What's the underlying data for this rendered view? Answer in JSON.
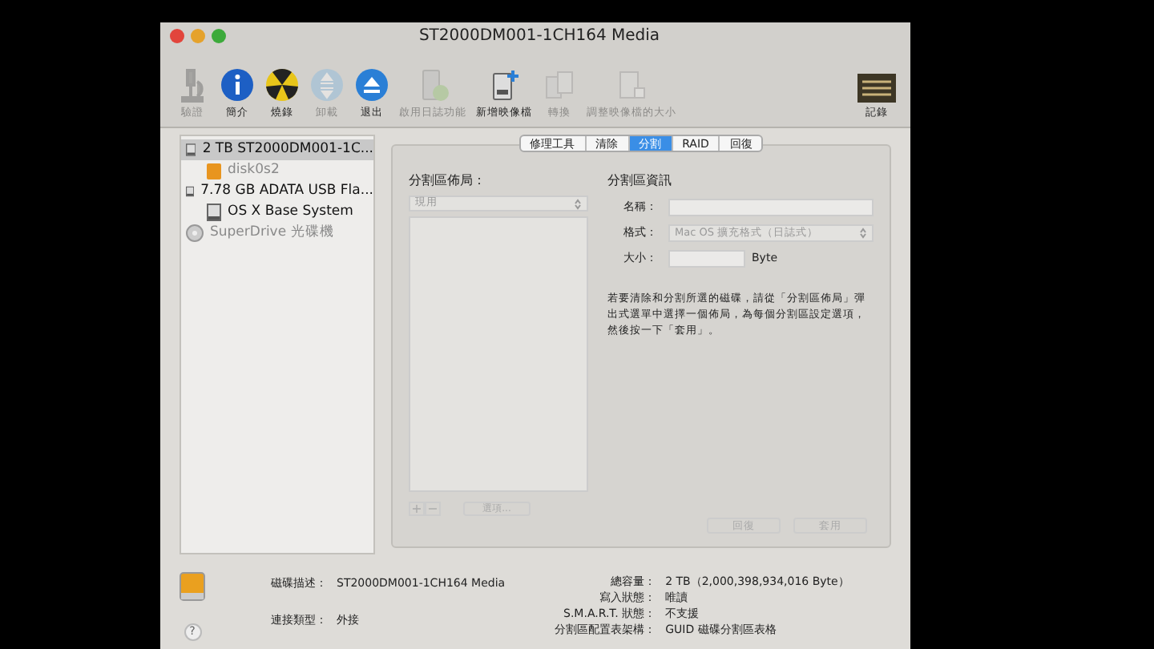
{
  "window": {
    "title": "ST2000DM001-1CH164 Media"
  },
  "toolbar": [
    {
      "label": "驗證",
      "disabled": true,
      "kind": "microscope"
    },
    {
      "label": "簡介",
      "disabled": false,
      "kind": "info"
    },
    {
      "label": "燒錄",
      "disabled": false,
      "kind": "burn"
    },
    {
      "label": "卸載",
      "disabled": true,
      "kind": "unmount"
    },
    {
      "label": "退出",
      "disabled": false,
      "kind": "eject"
    },
    {
      "label": "啟用日誌功能",
      "disabled": true,
      "kind": "journal"
    },
    {
      "label": "新增映像檔",
      "disabled": false,
      "kind": "newimage"
    },
    {
      "label": "轉換",
      "disabled": true,
      "kind": "convert"
    },
    {
      "label": "調整映像檔的大小",
      "disabled": true,
      "kind": "resize"
    },
    {
      "label": "記錄",
      "disabled": false,
      "kind": "log"
    }
  ],
  "sidebar": [
    {
      "label": "2 TB ST2000DM001-1C...",
      "selected": true,
      "disabled": false,
      "kind": "disk",
      "children": [
        {
          "label": "disk0s2",
          "selected": false,
          "disabled": true,
          "kind": "volume"
        }
      ]
    },
    {
      "label": "7.78 GB ADATA USB Fla...",
      "selected": false,
      "disabled": false,
      "kind": "disk",
      "children": [
        {
          "label": "OS X Base System",
          "selected": false,
          "disabled": false,
          "kind": "disk"
        }
      ]
    },
    {
      "label": "SuperDrive 光碟機",
      "selected": false,
      "disabled": true,
      "kind": "optical"
    }
  ],
  "tabs": [
    {
      "label": "修理工具",
      "selected": false
    },
    {
      "label": "清除",
      "selected": false
    },
    {
      "label": "分割",
      "selected": true
    },
    {
      "label": "RAID",
      "selected": false
    },
    {
      "label": "回復",
      "selected": false
    }
  ],
  "layout": {
    "title": "分割區佈局：",
    "dropdown": "現用",
    "add": "+",
    "remove": "−",
    "options_button": "選項..."
  },
  "info": {
    "title": "分割區資訊",
    "name_label": "名稱：",
    "format_label": "格式：",
    "format_value": "Mac OS 擴充格式（日誌式）",
    "size_label": "大小：",
    "size_unit": "Byte",
    "help": "若要清除和分割所選的磁碟，請從「分割區佈局」彈出式選單中選擇一個佈局，為每個分割區設定選項，然後按一下「套用」。"
  },
  "buttons": [
    {
      "label": "回復",
      "disabled": true
    },
    {
      "label": "套用",
      "disabled": true
    }
  ],
  "details_left": [
    {
      "label": "磁碟描述：",
      "value": "ST2000DM001-1CH164 Media"
    },
    {
      "label": "連接類型：",
      "value": "外接"
    }
  ],
  "details_right": [
    {
      "label": "總容量：",
      "value": "2 TB（2,000,398,934,016 Byte）"
    },
    {
      "label": "寫入狀態：",
      "value": "唯讀"
    },
    {
      "label": "S.M.A.R.T. 狀態：",
      "value": "不支援"
    },
    {
      "label": "分割區配置表架構：",
      "value": "GUID 磁碟分割區表格"
    }
  ],
  "help_button": "?"
}
